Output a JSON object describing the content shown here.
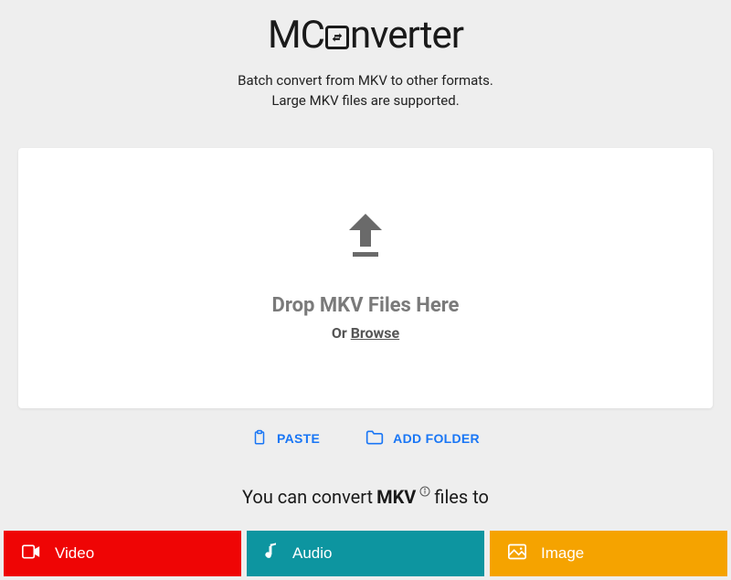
{
  "logo": {
    "prefix": "MC",
    "suffix": "nverter"
  },
  "subtitle": {
    "line1": "Batch convert from MKV to other formats.",
    "line2": "Large MKV files are supported."
  },
  "dropzone": {
    "title": "Drop MKV Files Here",
    "or": "Or ",
    "browse": "Browse"
  },
  "actions": {
    "paste": "PASTE",
    "addFolder": "ADD FOLDER"
  },
  "convertLine": {
    "prefix": "You can convert ",
    "format": "MKV",
    "suffix": " files to"
  },
  "tabs": {
    "video": "Video",
    "audio": "Audio",
    "image": "Image"
  }
}
